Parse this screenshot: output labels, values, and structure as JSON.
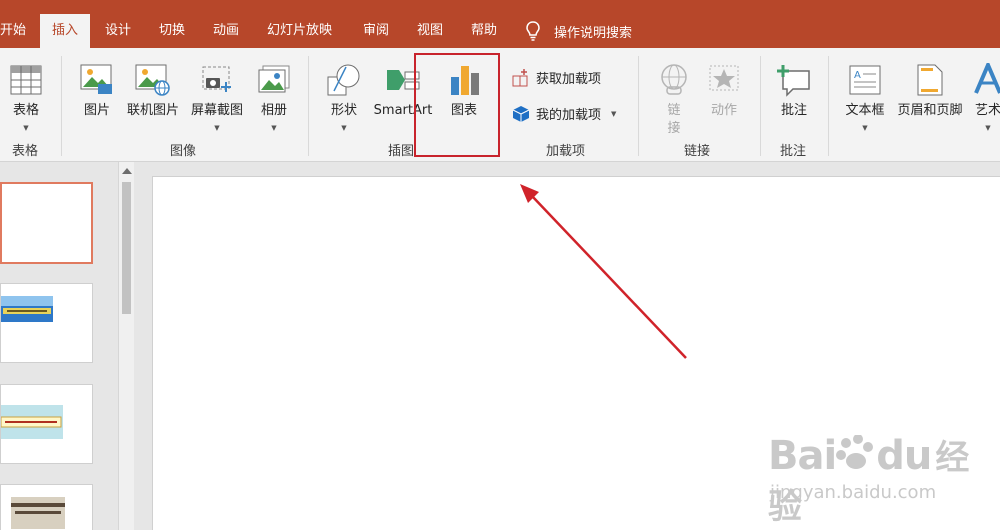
{
  "tabs": [
    {
      "label": "开始"
    },
    {
      "label": "插入",
      "active": true
    },
    {
      "label": "设计"
    },
    {
      "label": "切换"
    },
    {
      "label": "动画"
    },
    {
      "label": "幻灯片放映"
    },
    {
      "label": "审阅"
    },
    {
      "label": "视图"
    },
    {
      "label": "帮助"
    }
  ],
  "tellme": {
    "label": "操作说明搜索",
    "icon": "lightbulb-icon"
  },
  "ribbon": {
    "table": {
      "button": "表格",
      "group": "表格"
    },
    "images": {
      "picture": "图片",
      "online_picture": "联机图片",
      "screenshot": "屏幕截图",
      "album": "相册",
      "group": "图像"
    },
    "illustrations": {
      "shapes": "形状",
      "smartart": "SmartArt",
      "chart": "图表",
      "group": "插图"
    },
    "addins": {
      "get": "获取加载项",
      "mine": "我的加载项",
      "group": "加载项"
    },
    "links": {
      "link": "链\n接",
      "action": "动作",
      "group": "链接"
    },
    "comments": {
      "comment": "批注",
      "group": "批注"
    },
    "text": {
      "textbox": "文本框",
      "header_footer": "页眉和页脚",
      "wordart": "艺术"
    }
  },
  "colors": {
    "accent": "#b7472a",
    "highlight_box": "#c8232c",
    "arrow": "#d0232a"
  },
  "watermark": {
    "brand": "Bai",
    "brand2": "du",
    "brand_cn": "经验",
    "url": "jingyan.baidu.com"
  }
}
